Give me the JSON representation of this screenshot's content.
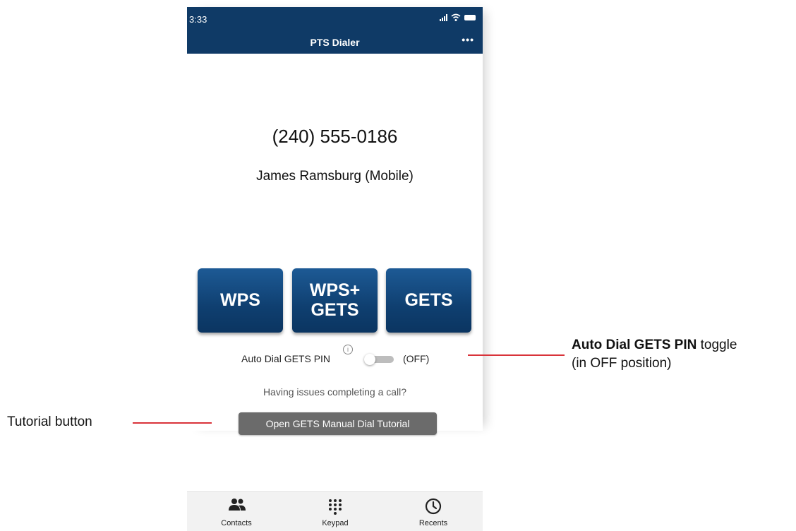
{
  "status_bar": {
    "time": "3:33"
  },
  "header": {
    "title": "PTS Dialer",
    "menu_label": "•••"
  },
  "call": {
    "phone_number": "(240) 555-0186",
    "contact_name": "James Ramsburg (Mobile)"
  },
  "dial_buttons": {
    "wps": "WPS",
    "wps_gets_line1": "WPS+",
    "wps_gets_line2": "GETS",
    "gets": "GETS"
  },
  "auto_dial": {
    "label": "Auto Dial GETS PIN",
    "info": "i",
    "state": "(OFF)",
    "on": false
  },
  "help": {
    "issues_text": "Having issues completing a call?",
    "tutorial_button": "Open GETS Manual Dial Tutorial"
  },
  "tabs": [
    {
      "label": "Contacts",
      "icon": "contacts-icon"
    },
    {
      "label": "Keypad",
      "icon": "keypad-icon"
    },
    {
      "label": "Recents",
      "icon": "clock-icon"
    }
  ],
  "annotations": {
    "toggle_bold": "Auto Dial GETS PIN",
    "toggle_rest": " toggle",
    "toggle_line2": "(in OFF position)",
    "tutorial": "Tutorial button"
  },
  "colors": {
    "header_bg": "#0f3a66",
    "button_bg": "#0f3f70",
    "annotation_line": "#d9333a",
    "tutorial_bg": "#6b6b6b"
  }
}
